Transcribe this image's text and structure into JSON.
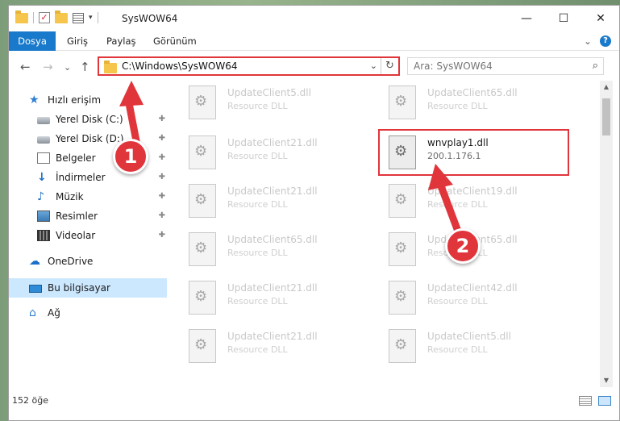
{
  "window": {
    "title": "SysWOW64",
    "qat_dropdown": "▾",
    "controls": {
      "minimize": "—",
      "maximize": "☐",
      "close": "✕"
    }
  },
  "ribbon": {
    "file_tab": "Dosya",
    "tabs": [
      "Giriş",
      "Paylaş",
      "Görünüm"
    ],
    "expand_icon": "⌄",
    "help_icon": "?"
  },
  "nav": {
    "back": "←",
    "forward": "→",
    "recent": "⌄",
    "up": "↑"
  },
  "address": {
    "path": "C:\\Windows\\SysWOW64",
    "dropdown": "⌄",
    "refresh": "↻"
  },
  "search": {
    "placeholder": "Ara: SysWOW64",
    "icon": "⌕"
  },
  "sidebar": {
    "items": [
      {
        "label": "Hızlı erişim",
        "icon": "star-icon",
        "pinned": false
      },
      {
        "label": "Yerel Disk (C:)",
        "icon": "disk-icon",
        "pinned": true
      },
      {
        "label": "Yerel Disk (D:)",
        "icon": "disk-icon",
        "pinned": true
      },
      {
        "label": "Belgeler",
        "icon": "documents-icon",
        "pinned": true
      },
      {
        "label": "İndirmeler",
        "icon": "downloads-icon",
        "pinned": true
      },
      {
        "label": "Müzik",
        "icon": "music-icon",
        "pinned": true
      },
      {
        "label": "Resimler",
        "icon": "pictures-icon",
        "pinned": true
      },
      {
        "label": "Videolar",
        "icon": "videos-icon",
        "pinned": true
      },
      {
        "label": "OneDrive",
        "icon": "onedrive-icon",
        "pinned": false
      },
      {
        "label": "Bu bilgisayar",
        "icon": "this-pc-icon",
        "pinned": false,
        "selected": true
      },
      {
        "label": "Ağ",
        "icon": "network-icon",
        "pinned": false
      }
    ],
    "pin_glyph": "📌"
  },
  "files": [
    {
      "name": "UpdateClient5.dll",
      "desc": "Resource DLL"
    },
    {
      "name": "UpdateClient65.dll",
      "desc": "Resource DLL"
    },
    {
      "name": "UpdateClient21.dll",
      "desc": "Resource DLL"
    },
    {
      "name": "wnvplay1.dll",
      "desc": "200.1.176.1",
      "highlighted": true
    },
    {
      "name": "UpdateClient21.dll",
      "desc": "Resource DLL"
    },
    {
      "name": "UpdateClient19.dll",
      "desc": "Resource DLL"
    },
    {
      "name": "UpdateClient65.dll",
      "desc": "Resource DLL"
    },
    {
      "name": "UpdateClient65.dll",
      "desc": "Resource DLL"
    },
    {
      "name": "UpdateClient21.dll",
      "desc": "Resource DLL"
    },
    {
      "name": "UpdateClient42.dll",
      "desc": "Resource DLL"
    },
    {
      "name": "UpdateClient21.dll",
      "desc": "Resource DLL"
    },
    {
      "name": "UpdateClient5.dll",
      "desc": "Resource DLL"
    }
  ],
  "status": {
    "count": "152 öğe"
  },
  "callouts": {
    "one": "1",
    "two": "2"
  },
  "colors": {
    "accent": "#1979ca",
    "highlight": "#e0353b",
    "selected_bg": "#cce8ff"
  }
}
